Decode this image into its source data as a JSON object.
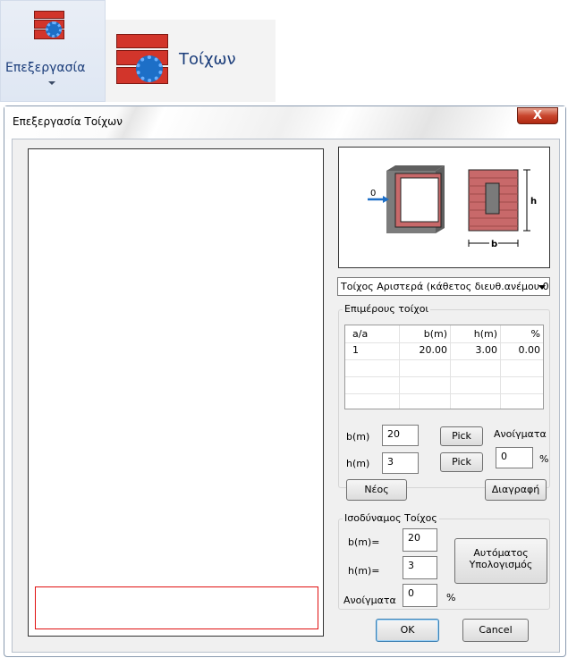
{
  "ribbon": {
    "button_label": "Επεξεργασία",
    "strip_label": "Τοίχων"
  },
  "dialog": {
    "title": "Επεξεργασία Τοίχων",
    "close_label": "X",
    "preview": {
      "arrow_label": "0",
      "dim_b": "b",
      "dim_h": "h"
    },
    "wall_select": "Τοίχος Αριστερά (κάθετος διευθ.ανέμου 0",
    "walls_group": {
      "label": "Επιμέρους τοίχοι",
      "columns": [
        "a/a",
        "b(m)",
        "h(m)",
        "%"
      ],
      "rows": [
        [
          "1",
          "20.00",
          "3.00",
          "0.00"
        ]
      ]
    },
    "b_label": "b(m)",
    "b_value": "20",
    "h_label": "h(m)",
    "h_value": "3",
    "pick_label": "Pick",
    "openings_label": "Ανοίγματα",
    "openings_value": "0",
    "percent": "%",
    "new_label": "Νέος",
    "delete_label": "Διαγραφή",
    "equiv_group": {
      "label": "Ισοδύναμος Τοίχος",
      "b_label": "b(m)=",
      "b_value": "20",
      "h_label": "h(m)=",
      "h_value": "3",
      "auto_line1": "Αυτόματος",
      "auto_line2": "Υπολογισμός",
      "openings_label": "Ανοίγματα",
      "openings_value": "0",
      "percent": "%"
    },
    "ok_label": "OK",
    "cancel_label": "Cancel"
  },
  "colors": {
    "brick": "#d2352b",
    "brick_panel": "#c8696a",
    "accent_blue": "#1d6fc7",
    "red_box": "#e01010"
  }
}
